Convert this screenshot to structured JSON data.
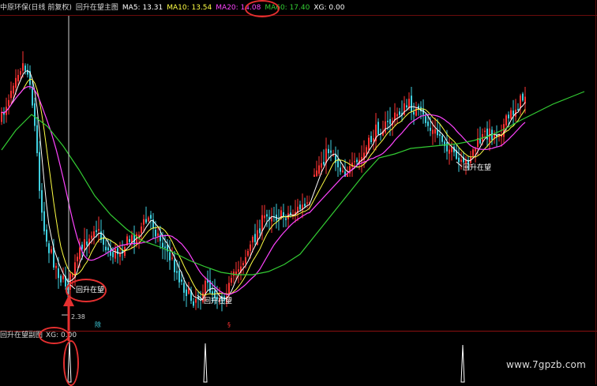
{
  "header": {
    "stock": "中原环保(日线 前复权)",
    "main_chart_name": "回升在望主图",
    "ma5": "MA5: 13.31",
    "ma10": "MA10: 13.54",
    "ma20": "MA20: 14.08",
    "ma60": "MA60: 17.40",
    "xg": "XG: 0.00"
  },
  "sub": {
    "name": "回升在望副图",
    "xg": "XG: 0.00"
  },
  "annotations": {
    "signal_text": "回升在望",
    "low_price": "2.38",
    "marker_blue": "除",
    "marker_red": "§"
  },
  "watermark": "www.7gpzb.com",
  "colors": {
    "background": "#000000",
    "ma5": "#ffffff",
    "ma10": "#ffff44",
    "ma20": "#ff44ff",
    "ma60": "#33cc33",
    "xg_text": "#ffffff",
    "highlight": "#e53030",
    "up_candle": "#ff3333",
    "down_candle": "#40d0e0"
  },
  "chart_data": {
    "type": "candlestick",
    "legend": [
      "MA5",
      "MA10",
      "MA20",
      "MA60"
    ],
    "signals": [
      "回升在望",
      "回升在望",
      "回升在望"
    ]
  }
}
